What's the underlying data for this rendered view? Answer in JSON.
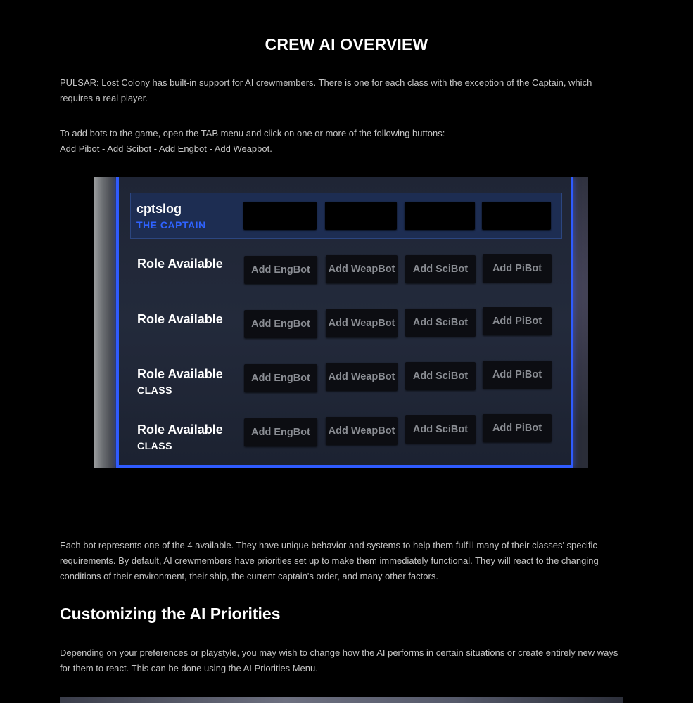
{
  "page_title": "CREW AI OVERVIEW",
  "intro_paragraph": "PULSAR: Lost Colony has built-in support for AI crewmembers. There is one for each class with the exception of the Captain, which requires a real player.",
  "instructions_line1": "To add bots to the game, open the TAB menu and click on one or more of the following buttons:",
  "instructions_line2": "Add Pibot - Add Scibot - Add Engbot - Add Weapbot.",
  "screenshot": {
    "captain_row": {
      "name": "cptslog",
      "role": "THE CAPTAIN"
    },
    "rows": [
      {
        "title": "Role Available",
        "sub": "",
        "buttons": [
          "Add EngBot",
          "Add WeapBot",
          "Add SciBot",
          "Add PiBot"
        ]
      },
      {
        "title": "Role Available",
        "sub": "",
        "buttons": [
          "Add EngBot",
          "Add WeapBot",
          "Add SciBot",
          "Add PiBot"
        ]
      },
      {
        "title": "Role Available",
        "sub": "CLASS",
        "buttons": [
          "Add EngBot",
          "Add WeapBot",
          "Add SciBot",
          "Add PiBot"
        ]
      },
      {
        "title": "Role Available",
        "sub": "CLASS",
        "buttons": [
          "Add EngBot",
          "Add WeapBot",
          "Add SciBot",
          "Add PiBot"
        ]
      }
    ],
    "accent_color": "#2f5bff"
  },
  "bot_paragraph": "Each bot represents one of the 4 available. They have unique behavior and systems to help them fulfill many of their classes' specific requirements. By default, AI crewmembers have priorities set up to make them immediately functional. They will react to the changing conditions of their environment, their ship, the current captain's order, and many other factors.",
  "section_heading": "Customizing the AI Priorities",
  "customize_paragraph": "Depending on your preferences or playstyle, you may wish to change how the AI performs in certain situations or create entirely new ways for them to react. This can be done using the AI Priorities Menu."
}
